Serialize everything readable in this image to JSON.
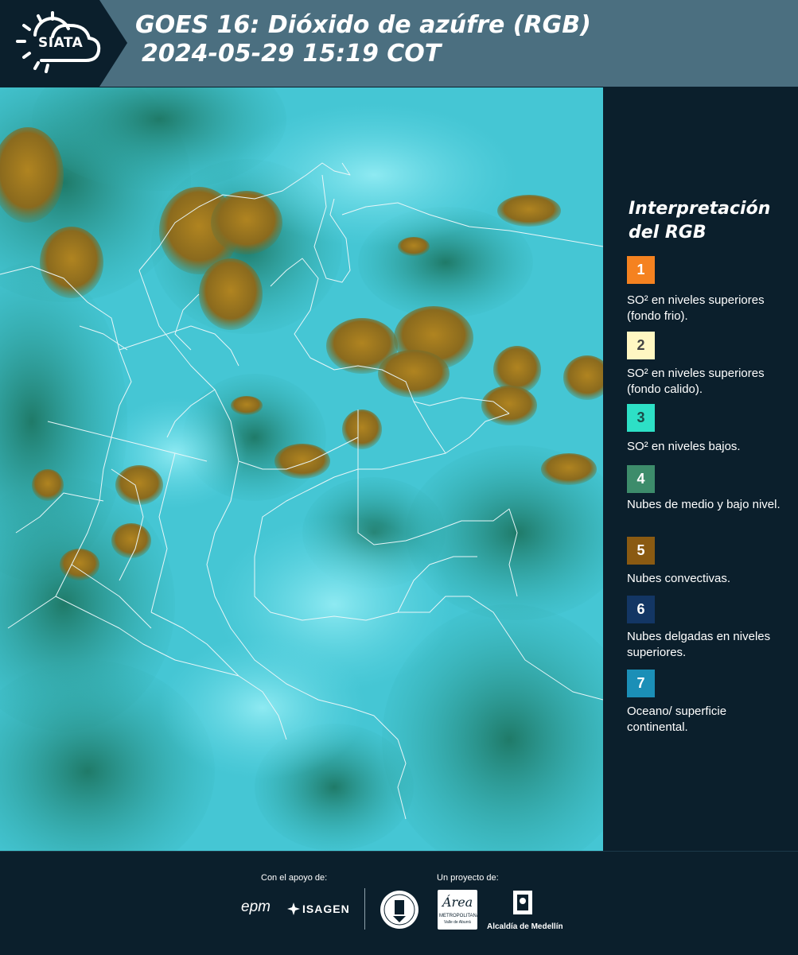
{
  "header": {
    "logo_text": "SIATA",
    "title_line1": "GOES 16: Dióxido de azúfre (RGB)",
    "title_line2": "2024-05-29 15:19 COT"
  },
  "legend": {
    "title": "Interpretación del RGB",
    "items": [
      {
        "number": "1",
        "color": "#f58220",
        "text_color": "#ffffff",
        "label": "SO² en niveles superiores (fondo frio)."
      },
      {
        "number": "2",
        "color": "#fff7c2",
        "text_color": "#444444",
        "label": "SO² en niveles superiores (fondo calido)."
      },
      {
        "number": "3",
        "color": "#2de0c6",
        "text_color": "#1b4c48",
        "label": "SO² en niveles bajos."
      },
      {
        "number": "4",
        "color": "#3d8c6b",
        "text_color": "#ffffff",
        "label": "Nubes de medio y bajo nivel."
      },
      {
        "number": "5",
        "color": "#8a5a12",
        "text_color": "#ffffff",
        "label": "Nubes convectivas."
      },
      {
        "number": "6",
        "color": "#133664",
        "text_color": "#ffffff",
        "label": "Nubes delgadas en niveles superiores."
      },
      {
        "number": "7",
        "color": "#1b8fb7",
        "text_color": "#ffffff",
        "label": "Oceano/ superficie continental."
      }
    ]
  },
  "footer": {
    "support_label": "Con el apoyo de:",
    "project_label": "Un proyecto de:",
    "sponsors": [
      "epm",
      "ISAGEN"
    ],
    "partners": [
      "Área Metropolitana",
      "Alcaldía de Medellín"
    ],
    "area_line1": "Área",
    "area_line2": "METROPOLITANA",
    "area_line3": "Valle de Aburrá"
  }
}
